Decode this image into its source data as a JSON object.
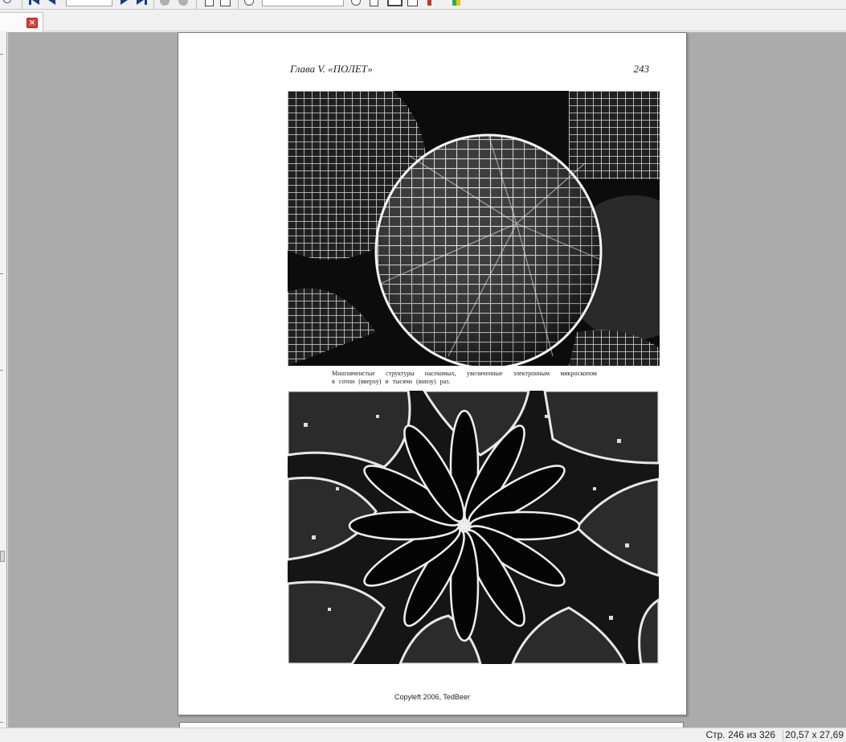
{
  "toolbar": {
    "page_input_value": "",
    "zoom_input_value": ""
  },
  "tab": {
    "close_label": "×"
  },
  "document_page": {
    "running_head": "Глава V. «ПОЛЕТ»",
    "page_number": "243",
    "caption_line1": "Многоячеистые структуры насекомых, увеличенные электронным микроскопом",
    "caption_line2": "в сотни (вверху) и тысячи (внизу) раз.",
    "footer": "Copyleft 2006, TedBeer"
  },
  "statusbar": {
    "page_info": "Стр. 246 из 326",
    "page_size": "20,57 x 27,69"
  }
}
